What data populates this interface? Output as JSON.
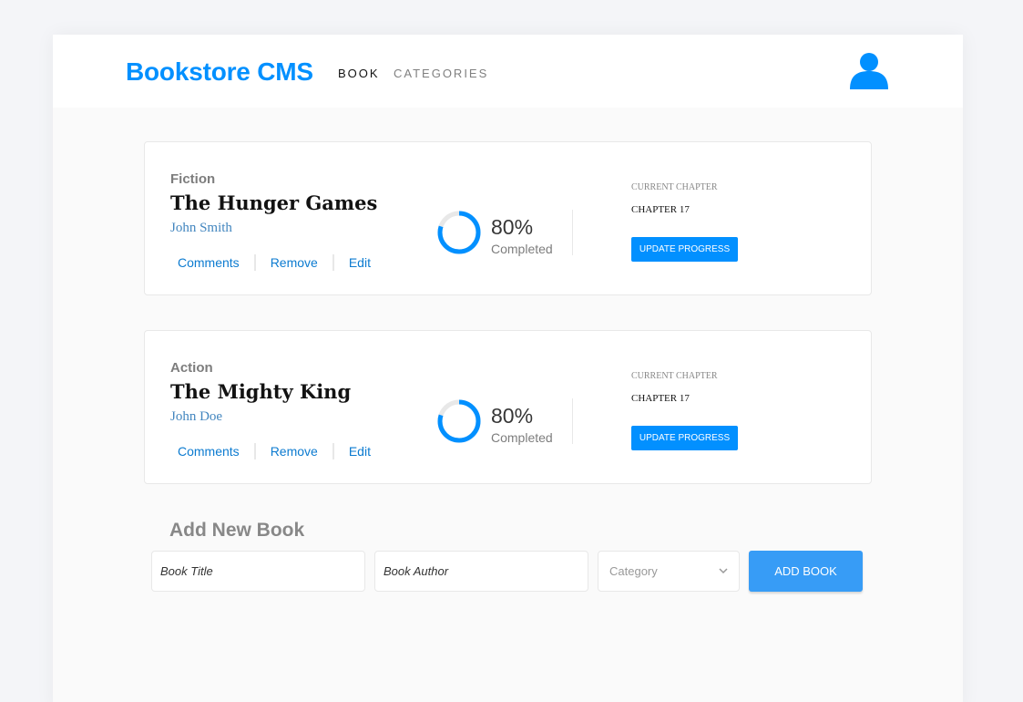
{
  "header": {
    "logo": "Bookstore CMS",
    "nav": [
      "BOOK",
      "CATEGORIES"
    ],
    "avatar_icon": "user-icon",
    "brand_color": "#0290ff"
  },
  "books": [
    {
      "genre": "Fiction",
      "title": "The Hunger Games",
      "author": "John Smith",
      "actions": [
        "Comments",
        "Remove",
        "Edit"
      ],
      "progress_percent": 80,
      "progress_text": "80%",
      "completed_label": "Completed",
      "current_chapter_label": "CURRENT CHAPTER",
      "current_chapter": "CHAPTER 17",
      "update_label": "UPDATE PROGRESS"
    },
    {
      "genre": "Action",
      "title": "The Mighty King",
      "author": "John Doe",
      "actions": [
        "Comments",
        "Remove",
        "Edit"
      ],
      "progress_percent": 80,
      "progress_text": "80%",
      "completed_label": "Completed",
      "current_chapter_label": "CURRENT CHAPTER",
      "current_chapter": "CHAPTER 17",
      "update_label": "UPDATE PROGRESS"
    }
  ],
  "add_form": {
    "heading": "Add New Book",
    "title_placeholder": "Book Title",
    "author_placeholder": "Book Author",
    "category_placeholder": "Category",
    "submit_label": "ADD BOOK"
  },
  "colors": {
    "accent": "#0290ff",
    "button": "#379cf6",
    "ring_track": "#e8e8e8"
  }
}
